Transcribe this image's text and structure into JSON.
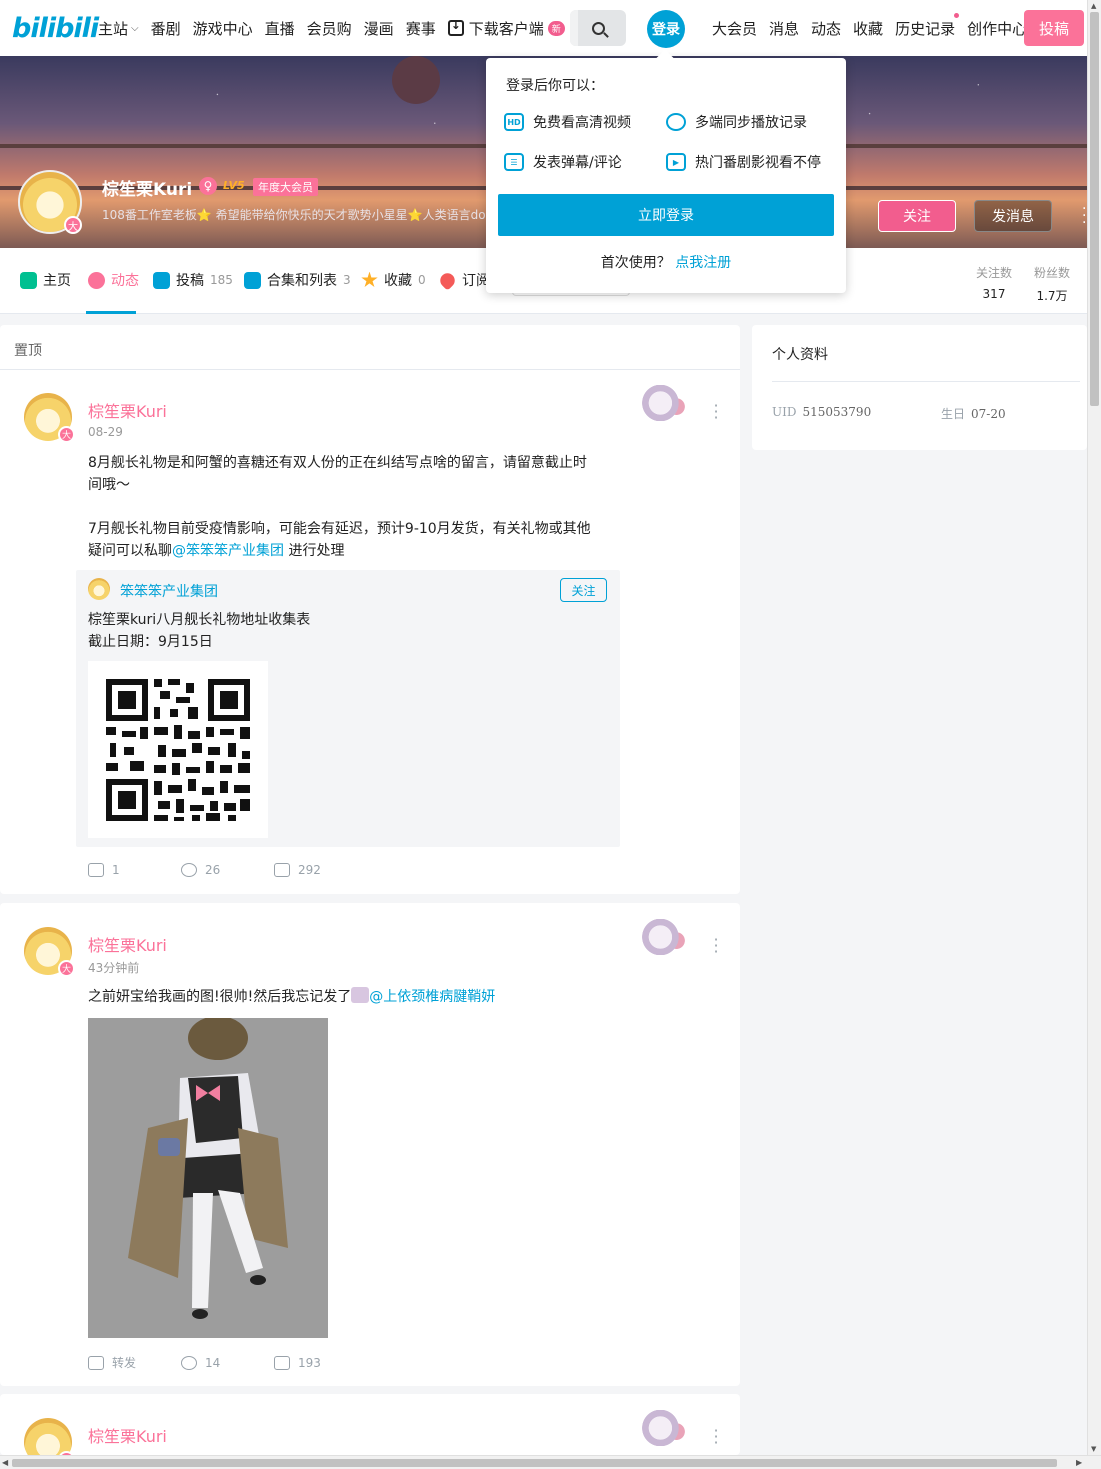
{
  "topnav": {
    "logo": "bilibili",
    "left_items": [
      "主站",
      "番剧",
      "游戏中心",
      "直播",
      "会员购",
      "漫画",
      "赛事",
      "下载客户端"
    ],
    "new_badge": "新",
    "login_label": "登录",
    "right_items": [
      "大会员",
      "消息",
      "动态",
      "收藏",
      "历史记录",
      "创作中心"
    ],
    "upload_label": "投稿"
  },
  "profile": {
    "name": "棕笙栗Kuri",
    "gender_symbol": "♀",
    "level": "LV5",
    "vip_label": "年度大会员",
    "vip_symbol": "大",
    "sign": "108番工作室老板⭐ 希望能带给你快乐的天才歌势小星星⭐人类语言dow",
    "follow_label": "关注",
    "message_label": "发消息"
  },
  "tabs": [
    {
      "label": "主页",
      "count": ""
    },
    {
      "label": "动态",
      "count": ""
    },
    {
      "label": "投稿",
      "count": "185"
    },
    {
      "label": "合集和列表",
      "count": "3"
    },
    {
      "label": "收藏",
      "count": "0"
    },
    {
      "label": "订阅",
      "count": ""
    }
  ],
  "stats": {
    "following_label": "关注数",
    "following": "317",
    "fans_label": "粉丝数",
    "fans": "1.7万"
  },
  "login_popover": {
    "title": "登录后你可以：",
    "perks": [
      "免费看高清视频",
      "多端同步播放记录",
      "发表弹幕/评论",
      "热门番剧影视看不停"
    ],
    "hd_icon_text": "HD",
    "login_button": "立即登录",
    "register_prompt": "首次使用？",
    "register_link": "点我注册"
  },
  "feed": {
    "pinned_label": "置顶",
    "posts": [
      {
        "author": "棕笙栗Kuri",
        "time": "08-29",
        "text_lines": [
          "8月舰长礼物是和阿蟹的喜糖还有双人份的正在纠结写点啥的留言，请留意截止时",
          "间哦～",
          "",
          "7月舰长礼物目前受疫情影响，可能会有延迟，预计9-10月发货，有关礼物或其他"
        ],
        "text_last_prefix": "疑问可以私聊",
        "text_last_at": "@笨笨笨产业集团",
        "text_last_suffix": " 进行处理",
        "repost": {
          "author": "笨笨笨产业集团",
          "follow_label": "关注",
          "lines": [
            "棕笙栗kuri八月舰长礼物地址收集表",
            "截止日期：9月15日"
          ]
        },
        "forward": "1",
        "comments": "26",
        "likes": "292"
      },
      {
        "author": "棕笙栗Kuri",
        "time": "43分钟前",
        "text_prefix": "之前妍宝给我画的图!很帅!然后我忘记发了",
        "text_at": "@上依颈椎病腱鞘妍",
        "forward": "转发",
        "comments": "14",
        "likes": "193"
      },
      {
        "author": "棕笙栗Kuri"
      }
    ]
  },
  "side_profile": {
    "title": "个人资料",
    "uid_label": "UID",
    "uid": "515053790",
    "birthday_label": "生日",
    "birthday": "07-20"
  },
  "colors": {
    "brand_blue": "#00a1d6",
    "brand_pink": "#fb7299"
  }
}
